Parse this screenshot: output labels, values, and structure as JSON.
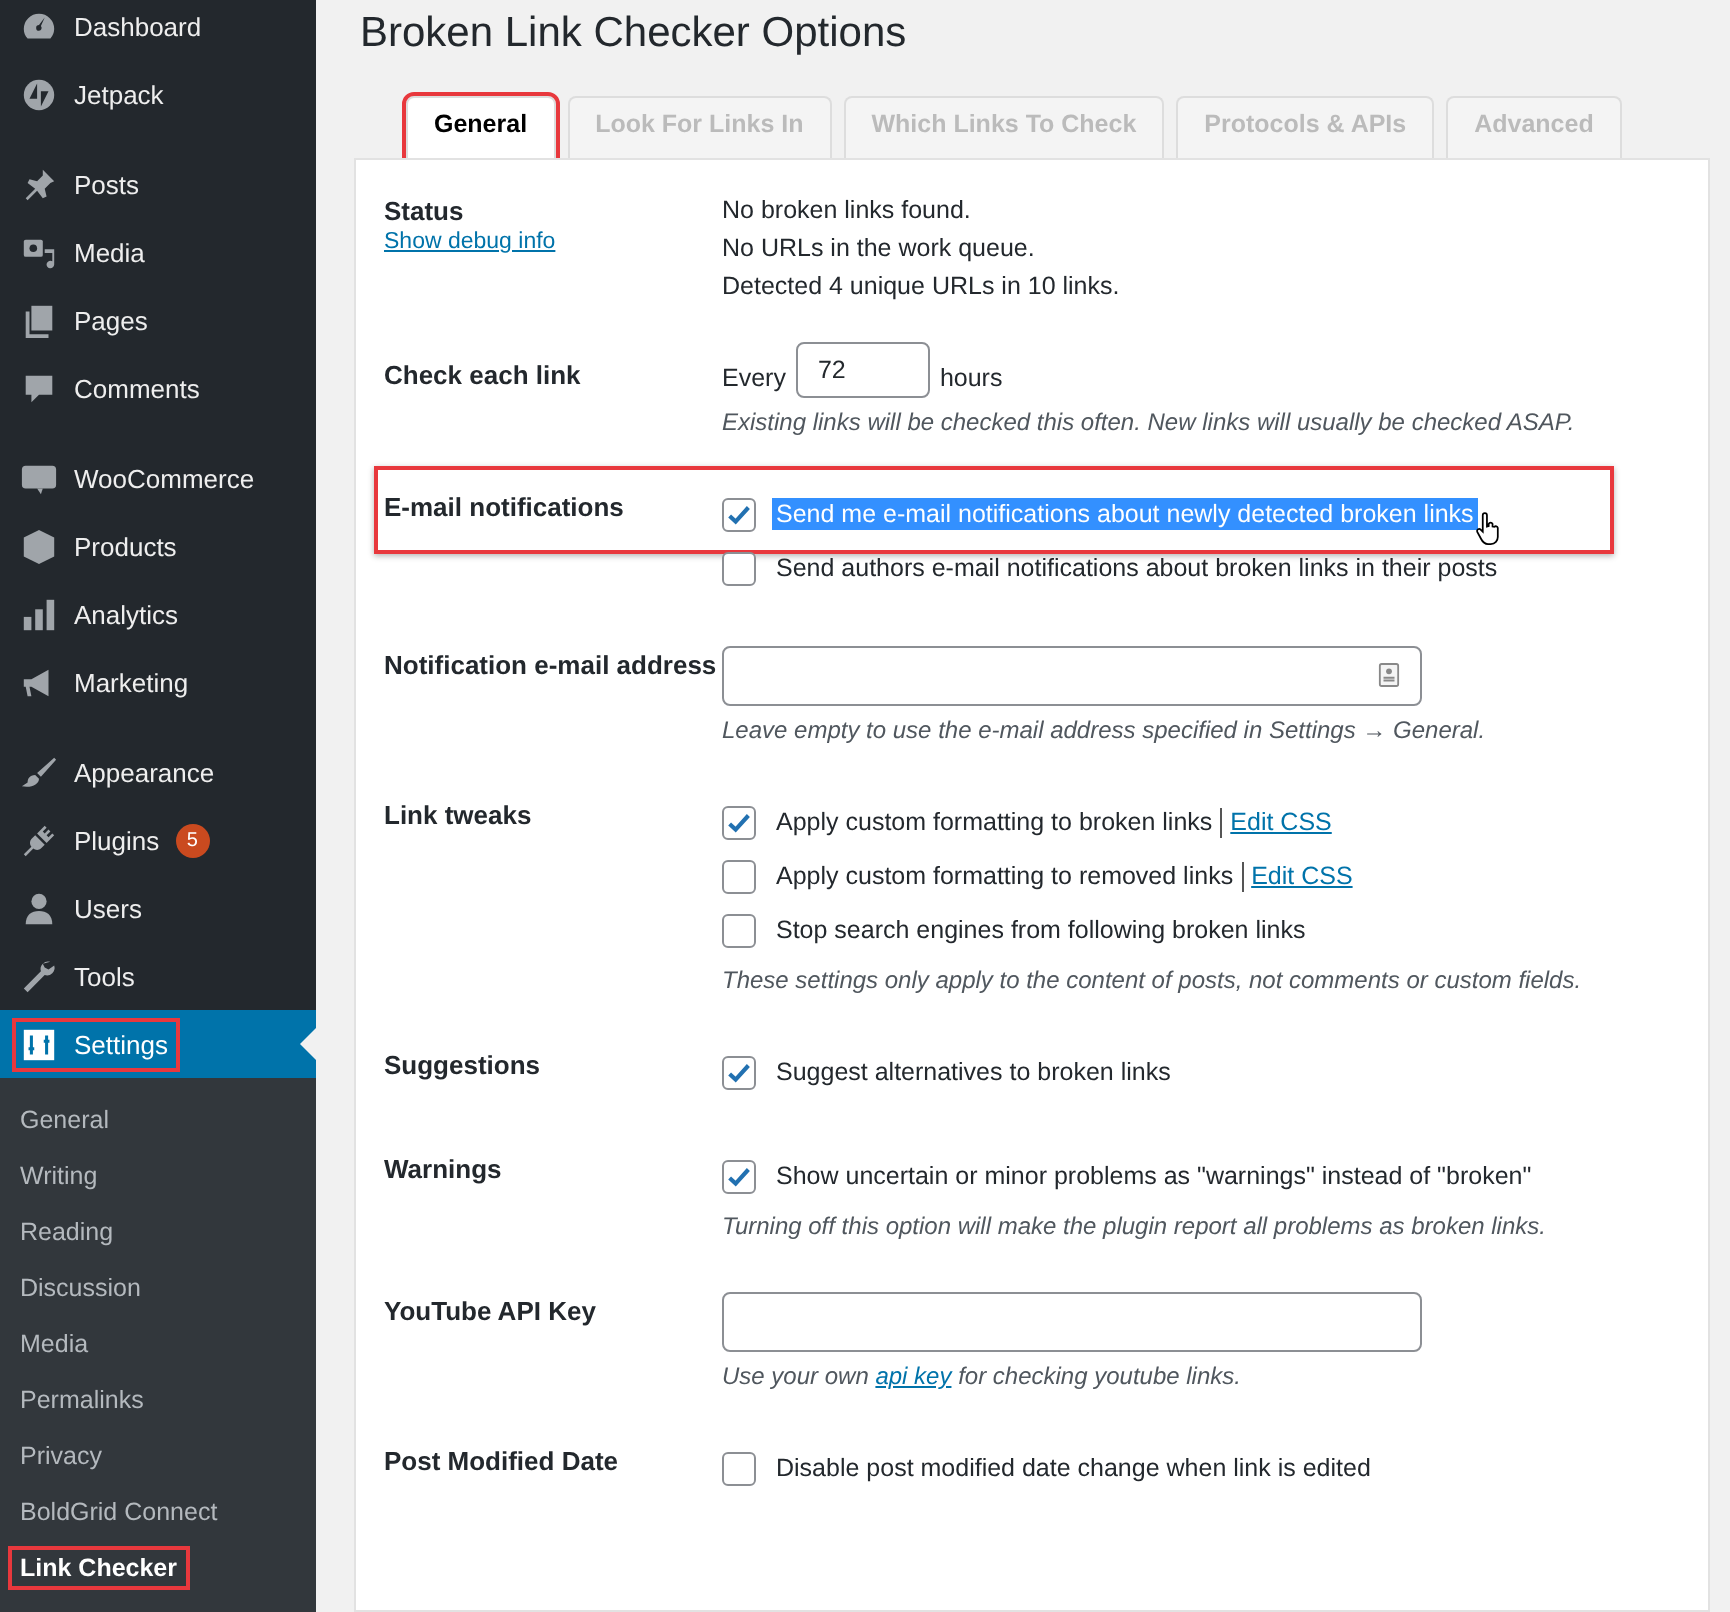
{
  "sidebar": {
    "groups": [
      [
        {
          "label": "Dashboard"
        },
        {
          "label": "Jetpack"
        }
      ],
      [
        {
          "label": "Posts"
        },
        {
          "label": "Media"
        },
        {
          "label": "Pages"
        },
        {
          "label": "Comments"
        }
      ],
      [
        {
          "label": "WooCommerce"
        },
        {
          "label": "Products"
        },
        {
          "label": "Analytics"
        },
        {
          "label": "Marketing"
        }
      ],
      [
        {
          "label": "Appearance"
        },
        {
          "label": "Plugins",
          "badge": "5"
        },
        {
          "label": "Users"
        },
        {
          "label": "Tools"
        },
        {
          "label": "Settings",
          "selected": true,
          "highlighted": true
        }
      ]
    ],
    "submenu": [
      {
        "label": "General",
        "selected": false,
        "highlighted": false
      },
      {
        "label": "Writing",
        "selected": false,
        "highlighted": false
      },
      {
        "label": "Reading",
        "selected": false,
        "highlighted": false
      },
      {
        "label": "Discussion",
        "selected": false,
        "highlighted": false
      },
      {
        "label": "Media",
        "selected": false,
        "highlighted": false
      },
      {
        "label": "Permalinks",
        "selected": false,
        "highlighted": false
      },
      {
        "label": "Privacy",
        "selected": false,
        "highlighted": false
      },
      {
        "label": "BoldGrid Connect",
        "selected": false,
        "highlighted": false
      },
      {
        "label": "Link Checker",
        "selected": true,
        "highlighted": true
      }
    ]
  },
  "page": {
    "title": "Broken Link Checker Options",
    "tabs": [
      {
        "label": "General",
        "selected": true,
        "highlighted": true
      },
      {
        "label": "Look For Links In",
        "selected": false,
        "highlighted": false
      },
      {
        "label": "Which Links To Check",
        "selected": false,
        "highlighted": false
      },
      {
        "label": "Protocols & APIs",
        "selected": false,
        "highlighted": false
      },
      {
        "label": "Advanced",
        "selected": false,
        "highlighted": false
      }
    ],
    "rows": [
      {
        "kind": "status",
        "label": "Status",
        "link": "Show debug info",
        "lines": [
          "No broken links found.",
          "No URLs in the work queue.",
          "Detected 4 unique URLs in 10 links."
        ]
      },
      {
        "kind": "interval",
        "label": "Check each link",
        "prefix": "Every",
        "value": "72",
        "suffix": "hours",
        "note": "Existing links will be checked this often. New links will usually be checked ASAP."
      },
      {
        "kind": "checks",
        "label": "E-mail notifications",
        "highlighted": true,
        "options": [
          {
            "label": "Send me e-mail notifications about newly detected broken links",
            "checked": true,
            "text_selected": true
          },
          {
            "label": "Send authors e-mail notifications about broken links in their posts",
            "checked": false,
            "text_selected": false
          }
        ]
      },
      {
        "kind": "field",
        "label": "Notification e-mail address",
        "contact_icon": true,
        "note": "Leave empty to use the e-mail address specified in Settings → General."
      },
      {
        "kind": "checks",
        "label": "Link tweaks",
        "options": [
          {
            "label": "Apply custom formatting to broken links",
            "checked": true,
            "link": "Edit CSS"
          },
          {
            "label": "Apply custom formatting to removed links",
            "checked": false,
            "link": "Edit CSS"
          },
          {
            "label": "Stop search engines from following broken links",
            "checked": false
          }
        ],
        "note": "These settings only apply to the content of posts, not comments or custom fields."
      },
      {
        "kind": "checks",
        "label": "Suggestions",
        "options": [
          {
            "label": "Suggest alternatives to broken links",
            "checked": true
          }
        ]
      },
      {
        "kind": "checks",
        "label": "Warnings",
        "options": [
          {
            "label": "Show uncertain or minor problems as \"warnings\" instead of \"broken\"",
            "checked": true
          }
        ],
        "note": "Turning off this option will make the plugin report all problems as broken links."
      },
      {
        "kind": "field",
        "label": "YouTube API Key",
        "contact_icon": false,
        "note_parts": {
          "before": "Use your own",
          "link": "api key",
          "after": "for checking youtube links."
        }
      },
      {
        "kind": "checks",
        "label": "Post Modified Date",
        "options": [
          {
            "label": "Disable post modified date change when link is edited",
            "checked": false
          }
        ]
      }
    ]
  }
}
